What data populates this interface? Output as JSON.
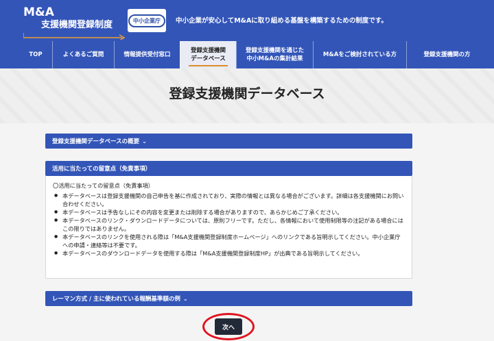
{
  "header": {
    "logo_title": "M&A",
    "logo_subtitle": "支援機関登録制度",
    "agency_badge": "中小企業庁",
    "tagline": "中小企業が安心してM&Aに取り組める基盤を構築するための制度です。"
  },
  "nav": {
    "items": [
      {
        "line1": "TOP",
        "line2": ""
      },
      {
        "line1": "よくあるご質問",
        "line2": ""
      },
      {
        "line1": "情報提供受付窓口",
        "line2": ""
      },
      {
        "line1": "登録支援機関",
        "line2": "データベース"
      },
      {
        "line1": "登録支援機関を通じた",
        "line2": "中小M&Aの集計結果"
      },
      {
        "line1": "M&Aをご検討されている方",
        "line2": ""
      },
      {
        "line1": "登録支援機関の方",
        "line2": ""
      }
    ],
    "active_index": 3
  },
  "page": {
    "title": "登録支援機関データベース"
  },
  "panels": {
    "overview_label": "登録支援機関データベースの概要",
    "notes_label": "活用に当たっての留意点（免責事項）",
    "notes_heading": "〇活用に当たっての留意点（免責事項）",
    "notes_items": [
      "本データベースは登録支援機関の自己申告を基に作成されており、実際の情報とは異なる場合がございます。詳細は各支援機関にお問い合わせください。",
      "本データベースは予告なしにその内容を変更または削除する場合がありますので、あらかじめご了承ください。",
      "本データベースのリンク・ダウンロードデータについては、原則フリーです。ただし、各情報において使用制限等の注記がある場合にはこの限りではありません。",
      "本データベースのリンクを使用される際は「M&A支援機関登録制度ホームページ」へのリンクである旨明示してください。中小企業庁への申請・連絡等は不要です。",
      "本データベースのダウンロードデータを使用する際は「M&A支援機関登録制度HP」が出典である旨明示してください。"
    ],
    "lehman_label": "レーマン方式 / 主に使われている報酬基準額の例"
  },
  "actions": {
    "next_label": "次へ"
  },
  "colors": {
    "brand_blue": "#3355b8",
    "highlight_red": "#e0141e",
    "active_underline": "#e08a2a"
  }
}
